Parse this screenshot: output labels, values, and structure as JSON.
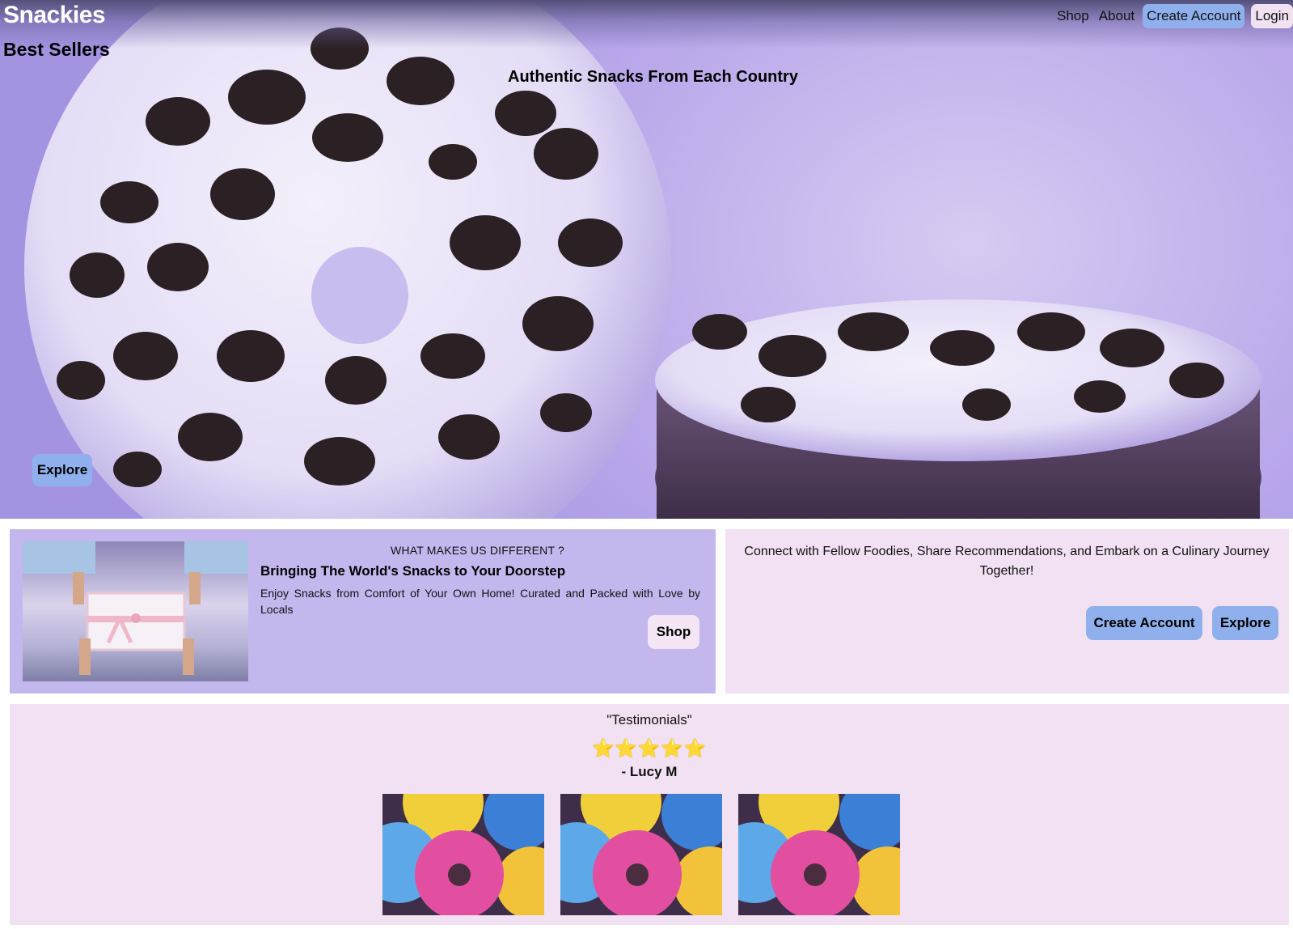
{
  "header": {
    "brand": "Snackies",
    "nav": {
      "shop": "Shop",
      "about": "About",
      "create_account": "Create Account",
      "login": "Login"
    }
  },
  "hero": {
    "best_sellers": "Best Sellers",
    "tagline": "Authentic Snacks From Each Country",
    "explore_label": "Explore"
  },
  "feature": {
    "kicker": "WHAT MAKES US DIFFERENT ?",
    "heading": "Bringing The World's Snacks to Your Doorstep",
    "body": "Enjoy Snacks from Comfort of Your Own Home! Curated and Packed with Love by Locals",
    "shop_label": "Shop"
  },
  "connect": {
    "text": "Connect with Fellow Foodies, Share Recommendations, and Embark on a Culinary Journey Together!",
    "create_label": "Create Account",
    "explore_label": "Explore"
  },
  "testimonials": {
    "title": "\"Testimonials\"",
    "stars": "⭐⭐⭐⭐⭐",
    "rating": 5,
    "author": "- Lucy M"
  },
  "colors": {
    "accent_button": "#8fb0ec",
    "hero_lavender": "#b9a8ea",
    "feature_panel": "#c4b7ee",
    "panel_pink": "#f1e1f2"
  }
}
